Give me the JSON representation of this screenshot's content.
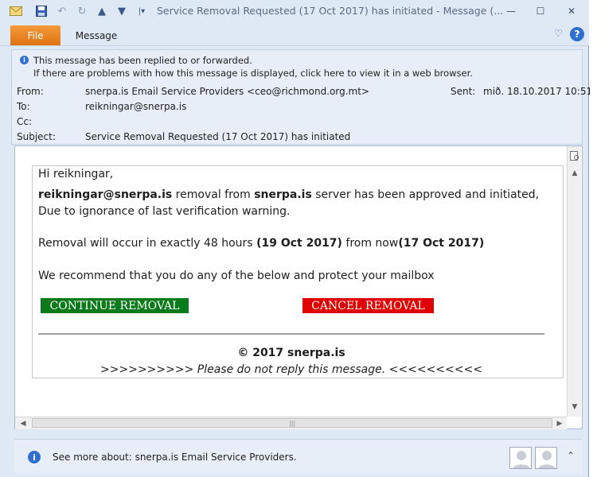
{
  "window": {
    "title": "Service Removal Requested (17 Oct 2017) has initiated  -  Message (...",
    "controls": {
      "minimize": "—",
      "maximize": "☐",
      "close": "✕"
    }
  },
  "ribbon": {
    "file_tab": "File",
    "message_tab": "Message",
    "expand": "♡",
    "help": "?"
  },
  "infobar": {
    "line1": "This message has been replied to or forwarded.",
    "line2": "If there are problems with how this message is displayed, click here to view it in a web browser."
  },
  "header": {
    "from_label": "From:",
    "from_value": "snerpa.is Email Service Providers <ceo@richmond.org.mt>",
    "to_label": "To:",
    "to_value": "reikningar@snerpa.is",
    "cc_label": "Cc:",
    "cc_value": "",
    "subject_label": "Subject:",
    "subject_value": "Service Removal Requested (17 Oct 2017) has initiated",
    "sent_label": "Sent:",
    "sent_value": "mið. 18.10.2017 10:51"
  },
  "body": {
    "greeting": "Hi reikningar,",
    "p1_email": "reikningar@snerpa.is",
    "p1_mid": " removal from ",
    "p1_domain": "snerpa.is",
    "p1_end": " server has been approved and initiated,",
    "p1_line2": "Due to ignorance of last verification warning.",
    "p2_start": "Removal will occur in exactly 48 hours ",
    "p2_date1": "(19 Oct 2017)",
    "p2_mid": "  from now",
    "p2_date2": "(17 Oct 2017)",
    "p3": "We recommend that you do any of the below and protect your mailbox",
    "continue_button": "CONTINUE REMOVAL",
    "cancel_button": "CANCEL REMOVAL",
    "copyright": "© 2017 snerpa.is",
    "noreply": ">>>>>>>>>> Please do not reply this message. <<<<<<<<<<"
  },
  "people_pane": {
    "text": "See more about: snerpa.is Email Service Providers.",
    "chevron": "⌃"
  },
  "colors": {
    "continue": "#0a7a1a",
    "cancel": "#e00000",
    "file_tab": "#e07212"
  }
}
